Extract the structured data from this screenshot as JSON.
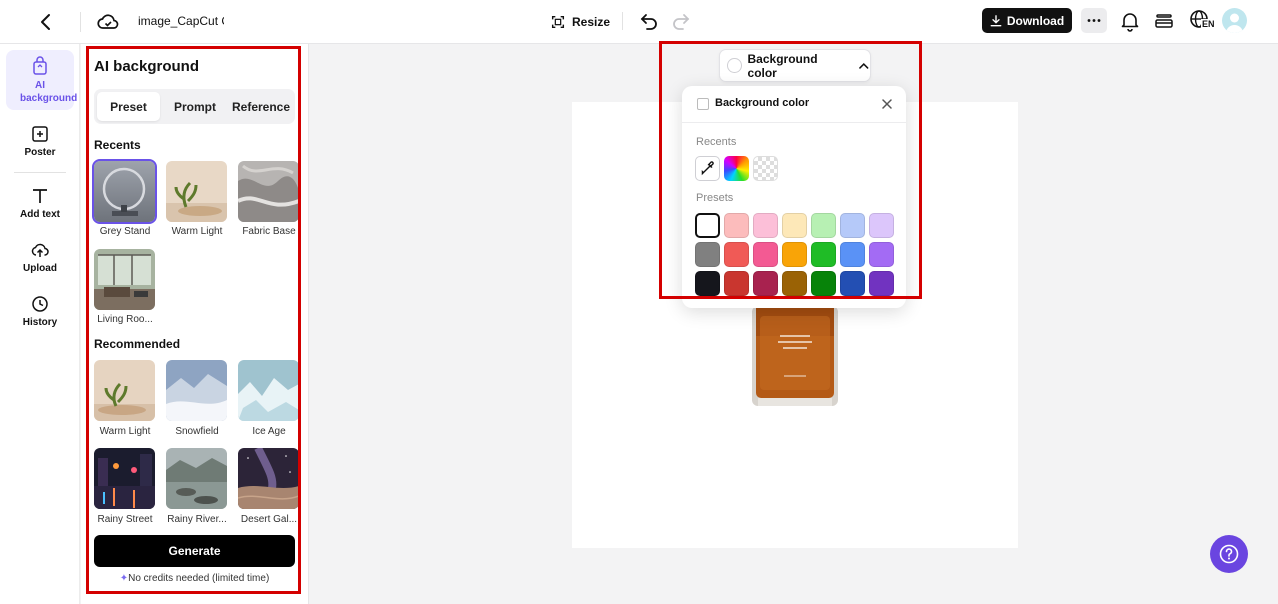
{
  "app": {
    "doc_title": "image_CapCut C",
    "resize_label": "Resize",
    "download_label": "Download",
    "lang_badge": "EN"
  },
  "rail": {
    "items": [
      {
        "label": "AI background"
      },
      {
        "label": "Poster"
      },
      {
        "label": "Add text"
      },
      {
        "label": "Upload"
      },
      {
        "label": "History"
      }
    ]
  },
  "panel": {
    "title": "AI background",
    "tabs": [
      "Preset",
      "Prompt",
      "Reference"
    ],
    "active_tab": "Preset",
    "recents_title": "Recents",
    "recents": [
      "Grey Stand",
      "Warm Light",
      "Fabric Base",
      "Living Roo..."
    ],
    "recommended_title": "Recommended",
    "recommended": [
      "Warm Light",
      "Snowfield",
      "Ice Age",
      "Rainy Street",
      "Rainy River...",
      "Desert Gal..."
    ],
    "generate_label": "Generate",
    "credits_note": "No credits needed (limited time)"
  },
  "bg_chip": {
    "label": "Background color"
  },
  "popover": {
    "title": "Background color",
    "recents_label": "Recents",
    "presets_label": "Presets",
    "presets": [
      [
        "#ffffff",
        "#fcbcbc",
        "#fcbfd8",
        "#fde8b8",
        "#b7f0b3",
        "#b5c9f9",
        "#dcc6fb"
      ],
      [
        "#808080",
        "#f05a56",
        "#f35a93",
        "#f9a407",
        "#1fbc26",
        "#5a92f6",
        "#a36bf4"
      ],
      [
        "#15161c",
        "#c9362f",
        "#a8224f",
        "#9a6205",
        "#078309",
        "#234fb3",
        "#7133c0"
      ]
    ],
    "selected_preset": "#ffffff"
  },
  "colors": {
    "accent": "#6a52e8",
    "highlight_outline": "#d40000",
    "help_button": "#6a45e0"
  }
}
